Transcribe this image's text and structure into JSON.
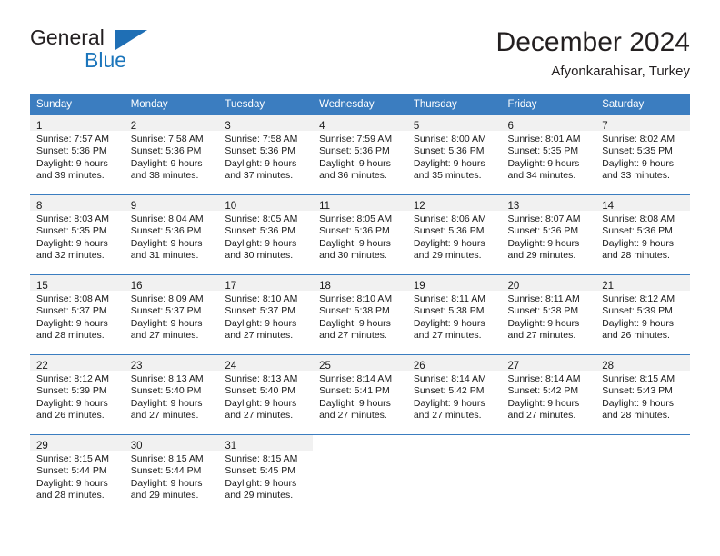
{
  "brand": {
    "name_dark": "General",
    "name_blue": "Blue",
    "triangle_color": "#1f6fb5"
  },
  "header": {
    "title": "December 2024",
    "subtitle": "Afyonkarahisar, Turkey"
  },
  "colors": {
    "header_blue": "#3b7dc0",
    "daynum_band": "#f1f1f1",
    "text": "#1a1a1a",
    "brand_blue": "#1b75bb"
  },
  "weekdays": [
    "Sunday",
    "Monday",
    "Tuesday",
    "Wednesday",
    "Thursday",
    "Friday",
    "Saturday"
  ],
  "labels": {
    "sunrise_prefix": "Sunrise:",
    "sunset_prefix": "Sunset:",
    "daylight_prefix": "Daylight:"
  },
  "weeks": [
    [
      {
        "day": "1",
        "sunrise": "Sunrise: 7:57 AM",
        "sunset": "Sunset: 5:36 PM",
        "daylight_1": "Daylight: 9 hours",
        "daylight_2": "and 39 minutes."
      },
      {
        "day": "2",
        "sunrise": "Sunrise: 7:58 AM",
        "sunset": "Sunset: 5:36 PM",
        "daylight_1": "Daylight: 9 hours",
        "daylight_2": "and 38 minutes."
      },
      {
        "day": "3",
        "sunrise": "Sunrise: 7:58 AM",
        "sunset": "Sunset: 5:36 PM",
        "daylight_1": "Daylight: 9 hours",
        "daylight_2": "and 37 minutes."
      },
      {
        "day": "4",
        "sunrise": "Sunrise: 7:59 AM",
        "sunset": "Sunset: 5:36 PM",
        "daylight_1": "Daylight: 9 hours",
        "daylight_2": "and 36 minutes."
      },
      {
        "day": "5",
        "sunrise": "Sunrise: 8:00 AM",
        "sunset": "Sunset: 5:36 PM",
        "daylight_1": "Daylight: 9 hours",
        "daylight_2": "and 35 minutes."
      },
      {
        "day": "6",
        "sunrise": "Sunrise: 8:01 AM",
        "sunset": "Sunset: 5:35 PM",
        "daylight_1": "Daylight: 9 hours",
        "daylight_2": "and 34 minutes."
      },
      {
        "day": "7",
        "sunrise": "Sunrise: 8:02 AM",
        "sunset": "Sunset: 5:35 PM",
        "daylight_1": "Daylight: 9 hours",
        "daylight_2": "and 33 minutes."
      }
    ],
    [
      {
        "day": "8",
        "sunrise": "Sunrise: 8:03 AM",
        "sunset": "Sunset: 5:35 PM",
        "daylight_1": "Daylight: 9 hours",
        "daylight_2": "and 32 minutes."
      },
      {
        "day": "9",
        "sunrise": "Sunrise: 8:04 AM",
        "sunset": "Sunset: 5:36 PM",
        "daylight_1": "Daylight: 9 hours",
        "daylight_2": "and 31 minutes."
      },
      {
        "day": "10",
        "sunrise": "Sunrise: 8:05 AM",
        "sunset": "Sunset: 5:36 PM",
        "daylight_1": "Daylight: 9 hours",
        "daylight_2": "and 30 minutes."
      },
      {
        "day": "11",
        "sunrise": "Sunrise: 8:05 AM",
        "sunset": "Sunset: 5:36 PM",
        "daylight_1": "Daylight: 9 hours",
        "daylight_2": "and 30 minutes."
      },
      {
        "day": "12",
        "sunrise": "Sunrise: 8:06 AM",
        "sunset": "Sunset: 5:36 PM",
        "daylight_1": "Daylight: 9 hours",
        "daylight_2": "and 29 minutes."
      },
      {
        "day": "13",
        "sunrise": "Sunrise: 8:07 AM",
        "sunset": "Sunset: 5:36 PM",
        "daylight_1": "Daylight: 9 hours",
        "daylight_2": "and 29 minutes."
      },
      {
        "day": "14",
        "sunrise": "Sunrise: 8:08 AM",
        "sunset": "Sunset: 5:36 PM",
        "daylight_1": "Daylight: 9 hours",
        "daylight_2": "and 28 minutes."
      }
    ],
    [
      {
        "day": "15",
        "sunrise": "Sunrise: 8:08 AM",
        "sunset": "Sunset: 5:37 PM",
        "daylight_1": "Daylight: 9 hours",
        "daylight_2": "and 28 minutes."
      },
      {
        "day": "16",
        "sunrise": "Sunrise: 8:09 AM",
        "sunset": "Sunset: 5:37 PM",
        "daylight_1": "Daylight: 9 hours",
        "daylight_2": "and 27 minutes."
      },
      {
        "day": "17",
        "sunrise": "Sunrise: 8:10 AM",
        "sunset": "Sunset: 5:37 PM",
        "daylight_1": "Daylight: 9 hours",
        "daylight_2": "and 27 minutes."
      },
      {
        "day": "18",
        "sunrise": "Sunrise: 8:10 AM",
        "sunset": "Sunset: 5:38 PM",
        "daylight_1": "Daylight: 9 hours",
        "daylight_2": "and 27 minutes."
      },
      {
        "day": "19",
        "sunrise": "Sunrise: 8:11 AM",
        "sunset": "Sunset: 5:38 PM",
        "daylight_1": "Daylight: 9 hours",
        "daylight_2": "and 27 minutes."
      },
      {
        "day": "20",
        "sunrise": "Sunrise: 8:11 AM",
        "sunset": "Sunset: 5:38 PM",
        "daylight_1": "Daylight: 9 hours",
        "daylight_2": "and 27 minutes."
      },
      {
        "day": "21",
        "sunrise": "Sunrise: 8:12 AM",
        "sunset": "Sunset: 5:39 PM",
        "daylight_1": "Daylight: 9 hours",
        "daylight_2": "and 26 minutes."
      }
    ],
    [
      {
        "day": "22",
        "sunrise": "Sunrise: 8:12 AM",
        "sunset": "Sunset: 5:39 PM",
        "daylight_1": "Daylight: 9 hours",
        "daylight_2": "and 26 minutes."
      },
      {
        "day": "23",
        "sunrise": "Sunrise: 8:13 AM",
        "sunset": "Sunset: 5:40 PM",
        "daylight_1": "Daylight: 9 hours",
        "daylight_2": "and 27 minutes."
      },
      {
        "day": "24",
        "sunrise": "Sunrise: 8:13 AM",
        "sunset": "Sunset: 5:40 PM",
        "daylight_1": "Daylight: 9 hours",
        "daylight_2": "and 27 minutes."
      },
      {
        "day": "25",
        "sunrise": "Sunrise: 8:14 AM",
        "sunset": "Sunset: 5:41 PM",
        "daylight_1": "Daylight: 9 hours",
        "daylight_2": "and 27 minutes."
      },
      {
        "day": "26",
        "sunrise": "Sunrise: 8:14 AM",
        "sunset": "Sunset: 5:42 PM",
        "daylight_1": "Daylight: 9 hours",
        "daylight_2": "and 27 minutes."
      },
      {
        "day": "27",
        "sunrise": "Sunrise: 8:14 AM",
        "sunset": "Sunset: 5:42 PM",
        "daylight_1": "Daylight: 9 hours",
        "daylight_2": "and 27 minutes."
      },
      {
        "day": "28",
        "sunrise": "Sunrise: 8:15 AM",
        "sunset": "Sunset: 5:43 PM",
        "daylight_1": "Daylight: 9 hours",
        "daylight_2": "and 28 minutes."
      }
    ],
    [
      {
        "day": "29",
        "sunrise": "Sunrise: 8:15 AM",
        "sunset": "Sunset: 5:44 PM",
        "daylight_1": "Daylight: 9 hours",
        "daylight_2": "and 28 minutes."
      },
      {
        "day": "30",
        "sunrise": "Sunrise: 8:15 AM",
        "sunset": "Sunset: 5:44 PM",
        "daylight_1": "Daylight: 9 hours",
        "daylight_2": "and 29 minutes."
      },
      {
        "day": "31",
        "sunrise": "Sunrise: 8:15 AM",
        "sunset": "Sunset: 5:45 PM",
        "daylight_1": "Daylight: 9 hours",
        "daylight_2": "and 29 minutes."
      },
      null,
      null,
      null,
      null
    ]
  ]
}
